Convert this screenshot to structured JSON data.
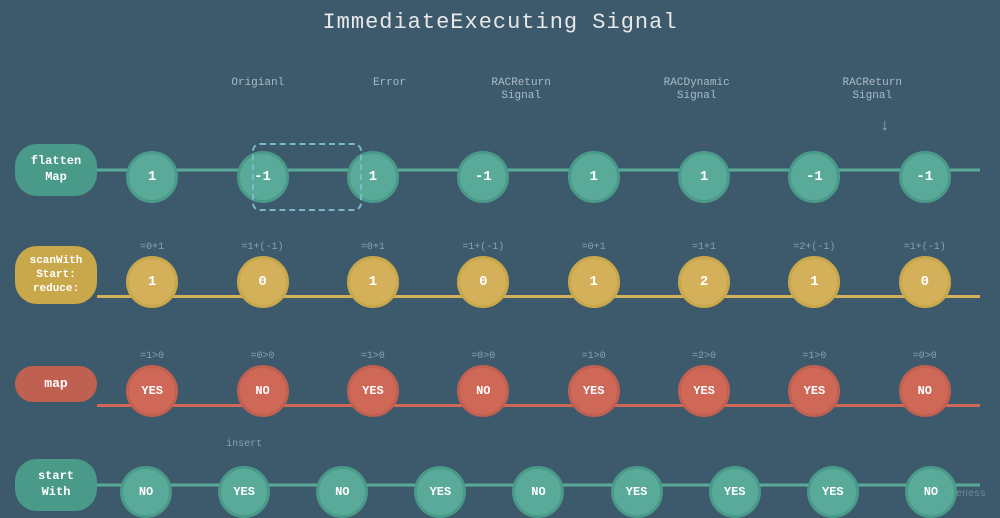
{
  "title": "ImmediateExecuting Signal",
  "col_headers": [
    {
      "label": "Origianl",
      "col": 0
    },
    {
      "label": "Error",
      "col": 1
    },
    {
      "label": "RACReturn\nSignal",
      "col": 2
    },
    {
      "label": "RACDynamic\nSignal",
      "col": 3
    },
    {
      "label": "RACReturn\nSignal",
      "col": 4
    }
  ],
  "rows": [
    {
      "id": "flattenMap",
      "label": "flatten\nMap",
      "color": "teal",
      "nodes": [
        {
          "value": "1",
          "annotation": ""
        },
        {
          "value": "-1",
          "annotation": ""
        },
        {
          "value": "1",
          "annotation": ""
        },
        {
          "value": "-1",
          "annotation": ""
        },
        {
          "value": "1",
          "annotation": ""
        },
        {
          "value": "1",
          "annotation": ""
        },
        {
          "value": "-1",
          "annotation": ""
        },
        {
          "value": "-1",
          "annotation": ""
        }
      ]
    },
    {
      "id": "scanWith",
      "label": "scanWith\nStart:\nreduce:",
      "color": "yellow",
      "nodes": [
        {
          "value": "1",
          "annotation": "=0+1"
        },
        {
          "value": "0",
          "annotation": "=1+(-1)"
        },
        {
          "value": "1",
          "annotation": "=0+1"
        },
        {
          "value": "0",
          "annotation": "=1+(-1)"
        },
        {
          "value": "1",
          "annotation": "=0+1"
        },
        {
          "value": "2",
          "annotation": "=1+1"
        },
        {
          "value": "1",
          "annotation": "=2+(-1)"
        },
        {
          "value": "0",
          "annotation": "=1+(-1)"
        }
      ]
    },
    {
      "id": "map",
      "label": "map",
      "color": "red",
      "nodes": [
        {
          "value": "YES",
          "annotation": "=1>0"
        },
        {
          "value": "NO",
          "annotation": "=0>0"
        },
        {
          "value": "YES",
          "annotation": "=1>0"
        },
        {
          "value": "NO",
          "annotation": "=0>0"
        },
        {
          "value": "YES",
          "annotation": "=1>0"
        },
        {
          "value": "YES",
          "annotation": "=2>0"
        },
        {
          "value": "YES",
          "annotation": "=1>0"
        },
        {
          "value": "NO",
          "annotation": "=0>0"
        }
      ]
    },
    {
      "id": "startWith",
      "label": "start\nWith",
      "color": "teal",
      "insert_label": "insert",
      "nodes": [
        {
          "value": "NO",
          "annotation": ""
        },
        {
          "value": "YES",
          "annotation": ""
        },
        {
          "value": "NO",
          "annotation": ""
        },
        {
          "value": "YES",
          "annotation": ""
        },
        {
          "value": "NO",
          "annotation": ""
        },
        {
          "value": "YES",
          "annotation": ""
        },
        {
          "value": "YES",
          "annotation": ""
        },
        {
          "value": "YES",
          "annotation": ""
        },
        {
          "value": "NO",
          "annotation": ""
        }
      ]
    }
  ],
  "watermark": "@Draveness"
}
